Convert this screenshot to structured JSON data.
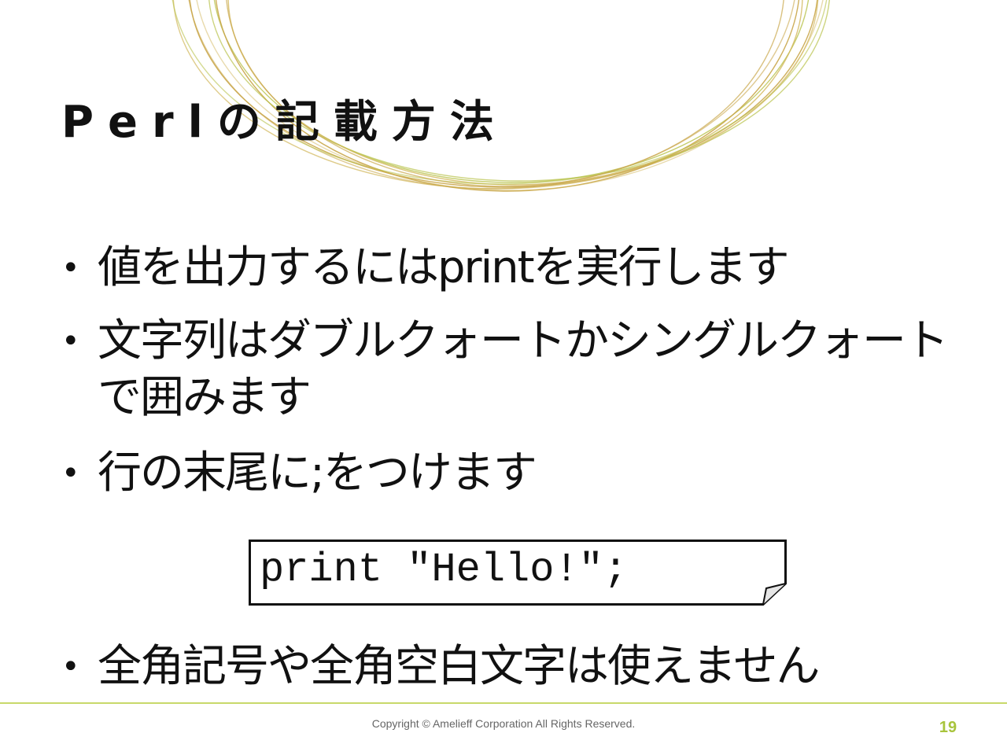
{
  "slide": {
    "title": "Perlの記載方法",
    "bullets": [
      "値を出力するにはprintを実行します",
      "文字列はダブルクォートかシングルクォートで囲みます",
      "行の末尾に;をつけます"
    ],
    "code": "print \"Hello!\";",
    "last_bullet": "全角記号や全角空白文字は使えません",
    "bullet_symbol": "•"
  },
  "footer": {
    "copyright": "Copyright © Amelieff Corporation All Rights Reserved.",
    "page_number": "19"
  },
  "colors": {
    "accent_gold": "#c9a64a",
    "accent_green": "#c8d96a",
    "page_number": "#a8c43c",
    "text": "#111111"
  },
  "icons": {
    "decoration": "gold-circle-lines",
    "code_box": "folded-corner-note"
  }
}
